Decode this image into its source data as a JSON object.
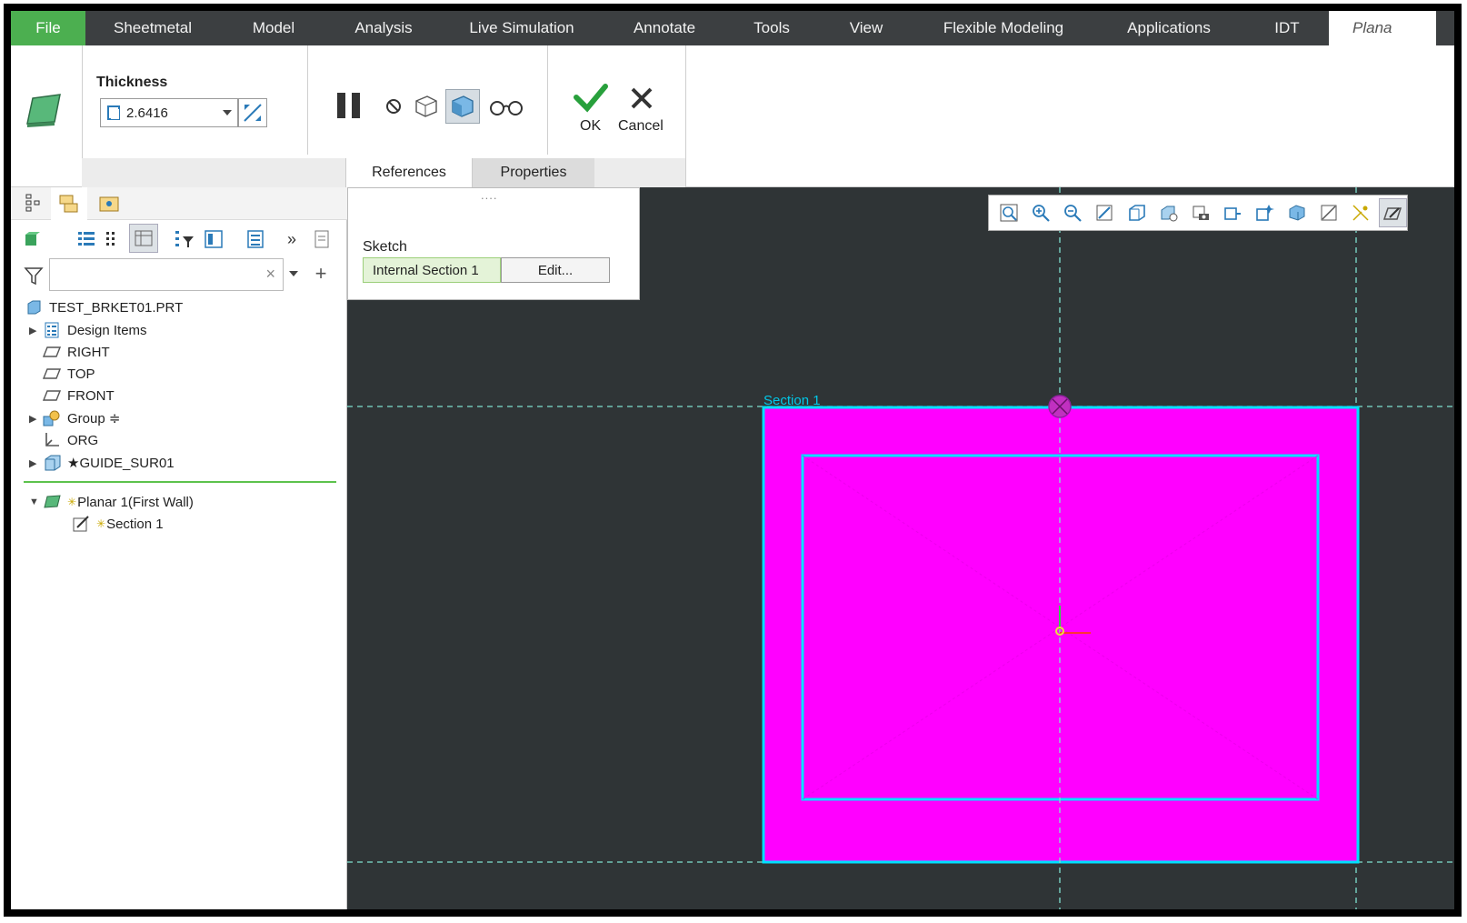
{
  "ribbon": {
    "tabs": [
      "File",
      "Sheetmetal",
      "Model",
      "Analysis",
      "Live Simulation",
      "Annotate",
      "Tools",
      "View",
      "Flexible Modeling",
      "Applications",
      "IDT"
    ],
    "active_tab": "Plana"
  },
  "dashboard": {
    "thickness_label": "Thickness",
    "thickness_value": "2.6416",
    "ok_label": "OK",
    "cancel_label": "Cancel",
    "tabs": [
      "References",
      "Properties"
    ]
  },
  "references_panel": {
    "sketch_label": "Sketch",
    "sketch_value": "Internal Section 1",
    "edit_button": "Edit...",
    "grip": "...."
  },
  "model_tree": {
    "root": "TEST_BRKET01.PRT",
    "items": [
      {
        "label": "Design Items",
        "expandable": true,
        "icon": "design-items-icon"
      },
      {
        "label": "RIGHT",
        "expandable": false,
        "icon": "datum-plane-icon"
      },
      {
        "label": "TOP",
        "expandable": false,
        "icon": "datum-plane-icon"
      },
      {
        "label": "FRONT",
        "expandable": false,
        "icon": "datum-plane-icon"
      },
      {
        "label": "Group ≑",
        "expandable": true,
        "icon": "group-icon"
      },
      {
        "label": "ORG",
        "expandable": false,
        "icon": "csys-icon"
      },
      {
        "label": "★GUIDE_SUR01",
        "expandable": true,
        "icon": "surface-icon"
      }
    ],
    "insert_items": [
      {
        "label": "Planar 1(First Wall)",
        "prefix": "✳",
        "icon": "planar-wall-icon"
      },
      {
        "label": "Section 1",
        "prefix": "✳",
        "icon": "sketch-icon"
      }
    ]
  },
  "graphics": {
    "section_label": "Section 1"
  },
  "colors": {
    "accent_green": "#4caf50",
    "section_fill": "#ff00ff",
    "section_edge": "#00e0ff",
    "datum_line": "#7fe0d0",
    "background": "#2f3436"
  }
}
